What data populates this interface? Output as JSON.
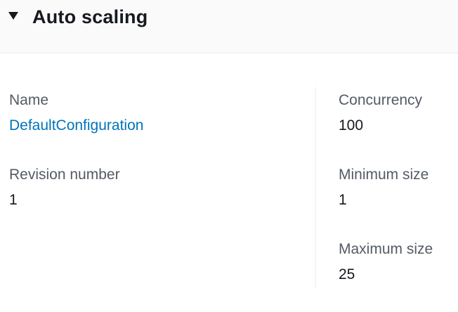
{
  "section": {
    "title": "Auto scaling",
    "expanded": true
  },
  "left": {
    "name_label": "Name",
    "name_value": "DefaultConfiguration",
    "revision_label": "Revision number",
    "revision_value": "1"
  },
  "right": {
    "concurrency_label": "Concurrency",
    "concurrency_value": "100",
    "min_label": "Minimum size",
    "min_value": "1",
    "max_label": "Maximum size",
    "max_value": "25"
  },
  "colors": {
    "link": "#0073bb",
    "label": "#545b64",
    "text": "#16191f",
    "header_bg": "#fafafa",
    "divider": "#eaeded"
  },
  "icons": {
    "expand": "caret-down-icon"
  }
}
